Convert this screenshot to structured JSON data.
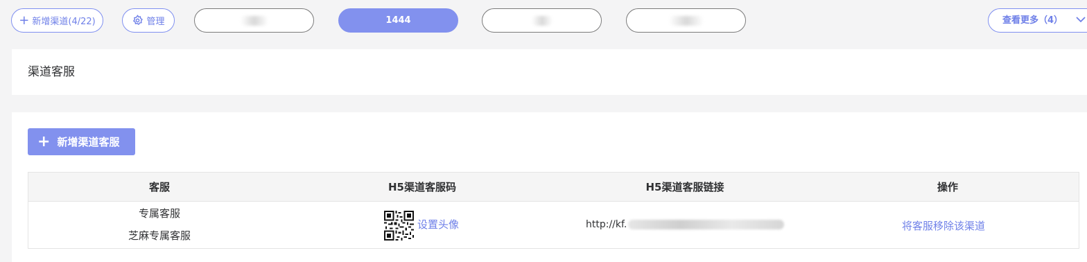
{
  "topbar": {
    "add_channel_label": "新增渠道(4/22)",
    "manage_label": "管理",
    "tabs": [
      {
        "label": ""
      },
      {
        "label": "1444"
      },
      {
        "label": ""
      },
      {
        "label": ""
      }
    ],
    "more_label": "查看更多（4）"
  },
  "section": {
    "title": "渠道客服"
  },
  "main": {
    "add_button_label": "新增渠道客服",
    "table": {
      "headers": [
        "客服",
        "H5渠道客服码",
        "H5渠道客服链接",
        "操作"
      ],
      "row": {
        "services": [
          "专属客服",
          "芝麻专属客服"
        ],
        "set_avatar_label": "设置头像",
        "url_prefix": "http://kf.",
        "action_label": "将客服移除该渠道"
      }
    }
  },
  "colors": {
    "accent": "#8291ee",
    "accent_text": "#6f80e8",
    "background": "#f4f4f5"
  },
  "icons": [
    "plus-icon",
    "gear-icon",
    "chevron-down-icon",
    "qr-code-icon"
  ]
}
